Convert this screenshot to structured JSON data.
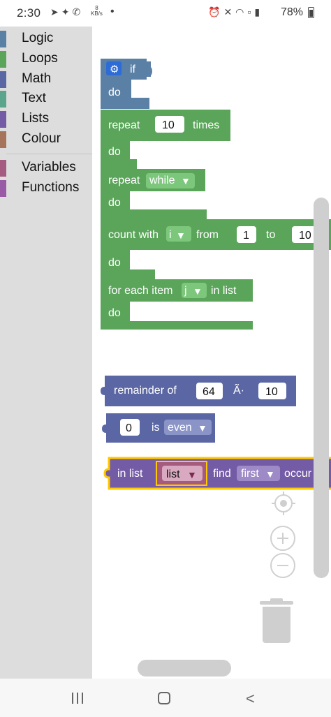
{
  "status_bar": {
    "time": "2:30",
    "left_icons": [
      "telegram-icon",
      "twitter-icon",
      "missed-call-icon"
    ],
    "network_speed_value": "8",
    "network_speed_unit": "KB/s",
    "dot": "•",
    "right_icons": [
      "alarm-icon",
      "mute-icon",
      "wifi-icon",
      "volte-icon",
      "signal-icon"
    ],
    "battery": "78%"
  },
  "toolbox": {
    "categories": [
      {
        "label": "Logic",
        "color": "#5b80a5"
      },
      {
        "label": "Loops",
        "color": "#5ba55b"
      },
      {
        "label": "Math",
        "color": "#5b67a5"
      },
      {
        "label": "Text",
        "color": "#5ba58c"
      },
      {
        "label": "Lists",
        "color": "#745ba5"
      },
      {
        "label": "Colour",
        "color": "#a5745b"
      },
      {
        "label": "Variables",
        "color": "#a55b80"
      },
      {
        "label": "Functions",
        "color": "#995ba5"
      }
    ]
  },
  "blocks": {
    "if_block": {
      "if_label": "if",
      "do_label": "do",
      "color": "#5b80a5",
      "gear_icon": "gear-icon"
    },
    "repeat_block": {
      "repeat_label": "repeat",
      "count": "10",
      "times_label": "times",
      "do_label": "do",
      "color": "#5ba55b"
    },
    "repeat_while_block": {
      "repeat_label": "repeat",
      "mode": "while",
      "do_label": "do"
    },
    "count_with_block": {
      "count_label": "count with",
      "var": "i",
      "from_label": "from",
      "from_value": "1",
      "to_label": "to",
      "to_value": "10",
      "do_label": "do"
    },
    "for_each_block": {
      "label": "for each item",
      "var": "j",
      "in_list_label": "in list",
      "do_label": "do"
    },
    "remainder_block": {
      "label": "remainder of",
      "dividend": "64",
      "operator": "Ã·",
      "divisor": "10",
      "color": "#5b67a5"
    },
    "is_even_block": {
      "value": "0",
      "is_label": "is",
      "property": "even"
    },
    "list_find_block": {
      "in_list_label": "in list",
      "list_var": "list",
      "find_label": "find",
      "mode": "first",
      "occurrence_label": "occur",
      "color": "#745ba5",
      "highlight": "#ffc900"
    }
  }
}
